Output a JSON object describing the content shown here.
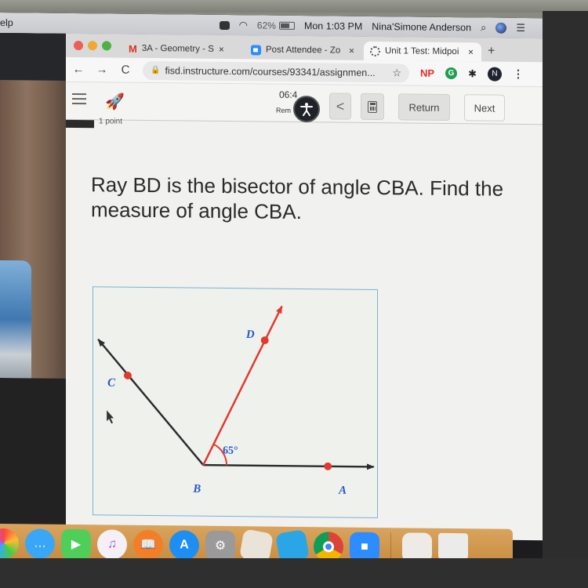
{
  "menubar": {
    "app_menu_partial": "elp",
    "battery_percent": "62%",
    "clock": "Mon 1:03 PM",
    "user_name": "Nina'Simone Anderson",
    "icons": [
      "zoom-meeting-icon",
      "wifi-icon",
      "battery-icon",
      "spotlight-search-icon",
      "siri-icon",
      "notification-center-icon"
    ]
  },
  "video_panel": {
    "next_button_glyph": "›"
  },
  "browser": {
    "tabs": [
      {
        "label": "3A - Geometry - S",
        "favicon": "gmail-icon",
        "active": false
      },
      {
        "label": "Post Attendee - Zo",
        "favicon": "zoom-icon",
        "active": false
      },
      {
        "label": "Unit 1 Test: Midpoi",
        "favicon": "canvas-icon",
        "active": true
      }
    ],
    "tab_close_glyph": "×",
    "new_tab_glyph": "+",
    "back_glyph": "←",
    "forward_glyph": "→",
    "reload_glyph": "C",
    "url": "fisd.instructure.com/courses/93341/assignmen...",
    "bookmark_glyph": "☆",
    "extensions": {
      "np_label": "NP",
      "g_label": "G",
      "puzzle_glyph": "✱",
      "profile_initial": "N"
    },
    "menu_glyph": "⋮"
  },
  "quiz_toolbar": {
    "timer_partial": "06:4",
    "timer_sub_partial": "Rem",
    "accessibility_glyph": "✱",
    "prev_glyph": "<",
    "return_label": "Return",
    "next_label": "Next"
  },
  "question": {
    "points_partial": "1 point",
    "text": "Ray BD is the bisector of angle CBA. Find the measure of angle CBA."
  },
  "figure": {
    "points": {
      "A": "A",
      "B": "B",
      "C": "C",
      "D": "D"
    },
    "angle_label": "65°",
    "given_angle": {
      "name": "DBA",
      "degrees": 65
    },
    "colors": {
      "ray_black": "#2b2b2b",
      "ray_red": "#e2392f",
      "point": "#e2392f",
      "label": "#2a56c9",
      "border": "#7fb0d4"
    }
  },
  "dock": {
    "apps": [
      {
        "name": "photos",
        "running": false
      },
      {
        "name": "messages",
        "running": false
      },
      {
        "name": "facetime",
        "running": false
      },
      {
        "name": "music",
        "running": true
      },
      {
        "name": "books",
        "running": false
      },
      {
        "name": "app-store",
        "running": false
      },
      {
        "name": "system-preferences",
        "running": false
      },
      {
        "name": "roblox-studio",
        "running": false
      },
      {
        "name": "roblox",
        "running": false
      },
      {
        "name": "chrome",
        "running": true
      },
      {
        "name": "zoom",
        "running": true
      },
      {
        "name": "downloads",
        "running": false
      },
      {
        "name": "trash",
        "running": false
      }
    ]
  }
}
